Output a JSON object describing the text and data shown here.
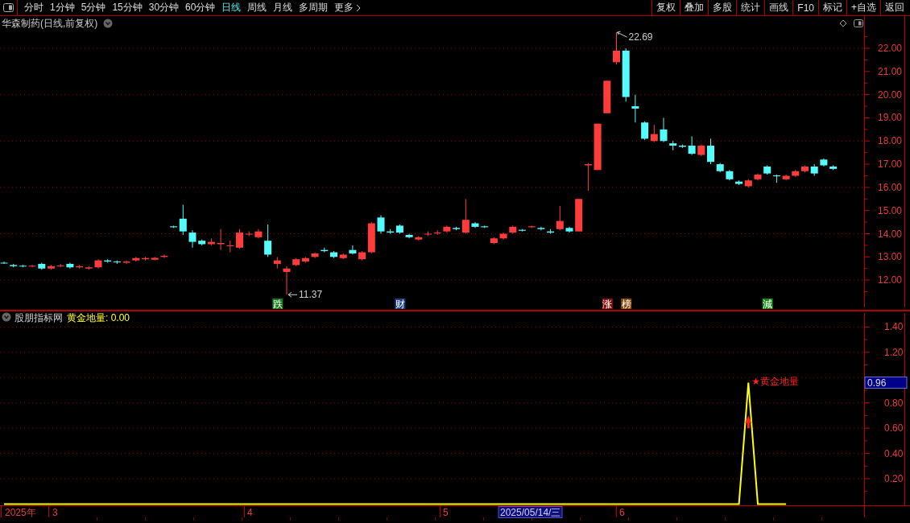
{
  "toolbar": {
    "periods": [
      {
        "label": "分时",
        "selected": false
      },
      {
        "label": "1分钟",
        "selected": false
      },
      {
        "label": "5分钟",
        "selected": false
      },
      {
        "label": "15分钟",
        "selected": false
      },
      {
        "label": "30分钟",
        "selected": false
      },
      {
        "label": "60分钟",
        "selected": false
      },
      {
        "label": "日线",
        "selected": true
      },
      {
        "label": "周线",
        "selected": false
      },
      {
        "label": "月线",
        "selected": false
      },
      {
        "label": "多周期",
        "selected": false
      }
    ],
    "more": "更多",
    "buttons": [
      "复权",
      "叠加",
      "多股",
      "统计",
      "画线",
      "F10",
      "标记",
      "+自选",
      "返回"
    ]
  },
  "price_chart": {
    "title": "华森制药(日线,前复权)",
    "high_label": "22.69",
    "low_label": "11.37",
    "markers": [
      {
        "text": "跌",
        "color": "#167a16"
      },
      {
        "text": "财",
        "color": "#1c3f8a"
      },
      {
        "text": "涨",
        "color": "#8a1010"
      },
      {
        "text": "榜",
        "color": "#8a4a10"
      },
      {
        "text": "減",
        "color": "#168a16"
      }
    ],
    "chart_data": {
      "type": "candlestick",
      "ylim": [
        10.72,
        23.39
      ],
      "yticks": [
        {
          "value": 22,
          "label": "22.00"
        },
        {
          "value": 21,
          "label": "21.00"
        },
        {
          "value": 20,
          "label": "20.00"
        },
        {
          "value": 19,
          "label": "19.00"
        },
        {
          "value": 18,
          "label": "18.00"
        },
        {
          "value": 17,
          "label": "17.00"
        },
        {
          "value": 16,
          "label": "16.00"
        },
        {
          "value": 15,
          "label": "15.00"
        },
        {
          "value": 14,
          "label": "14.00"
        },
        {
          "value": 13,
          "label": "13.00"
        },
        {
          "value": 12,
          "label": "12.00"
        }
      ],
      "categories": [
        null,
        null,
        null,
        null,
        null,
        null,
        null,
        null,
        null,
        null,
        null,
        null,
        null,
        null,
        null,
        null,
        null,
        null,
        null,
        null,
        null,
        null,
        null,
        null,
        null,
        null,
        null,
        null,
        null,
        null,
        null,
        null,
        null,
        null,
        null,
        null,
        null,
        null,
        null,
        null,
        null,
        null,
        null,
        null,
        null,
        null,
        null,
        null,
        null,
        null,
        null,
        null,
        null,
        null,
        null,
        null,
        null,
        null,
        null,
        null,
        null,
        null,
        null,
        null,
        null,
        null,
        null,
        null,
        null,
        null,
        null,
        null,
        null,
        null,
        null,
        null,
        null,
        null,
        null,
        null,
        null,
        null,
        null,
        null,
        null,
        null,
        null,
        null,
        null
      ],
      "ohlc": [
        [
          12.75,
          12.8,
          12.7,
          12.72
        ],
        [
          12.65,
          12.7,
          12.55,
          12.6
        ],
        [
          12.62,
          12.66,
          12.55,
          12.6
        ],
        [
          12.6,
          12.66,
          12.55,
          12.62
        ],
        [
          12.7,
          12.75,
          12.45,
          12.5
        ],
        [
          12.5,
          12.65,
          12.45,
          12.6
        ],
        [
          12.6,
          12.7,
          12.55,
          12.63
        ],
        [
          12.7,
          12.75,
          12.5,
          12.55
        ],
        [
          12.55,
          12.65,
          12.5,
          12.6
        ],
        [
          12.5,
          12.6,
          12.45,
          12.55
        ],
        [
          12.55,
          12.9,
          12.5,
          12.85
        ],
        [
          12.85,
          12.9,
          12.75,
          12.8
        ],
        [
          12.8,
          12.85,
          12.7,
          12.78
        ],
        [
          12.75,
          12.85,
          12.7,
          12.8
        ],
        [
          12.85,
          13.0,
          12.8,
          12.95
        ],
        [
          12.9,
          13.0,
          12.85,
          12.95
        ],
        [
          12.88,
          13.0,
          12.85,
          12.96
        ],
        [
          13.0,
          13.1,
          12.95,
          13.05
        ],
        [
          14.32,
          14.35,
          14.25,
          14.28
        ],
        [
          14.65,
          15.25,
          13.95,
          14.1
        ],
        [
          14.05,
          14.15,
          13.4,
          13.65
        ],
        [
          13.7,
          13.75,
          13.5,
          13.55
        ],
        [
          13.55,
          13.8,
          13.5,
          13.65
        ],
        [
          13.55,
          14.2,
          13.3,
          13.6
        ],
        [
          13.5,
          13.7,
          13.2,
          13.5
        ],
        [
          13.4,
          14.2,
          13.35,
          14.05
        ],
        [
          14.0,
          14.1,
          13.9,
          14.0
        ],
        [
          13.85,
          14.2,
          13.8,
          14.1
        ],
        [
          13.7,
          14.4,
          13.0,
          13.1
        ],
        [
          12.7,
          13.0,
          12.5,
          12.85
        ],
        [
          12.35,
          12.6,
          11.37,
          12.5
        ],
        [
          12.65,
          12.95,
          12.6,
          12.9
        ],
        [
          12.8,
          13.0,
          12.75,
          12.95
        ],
        [
          13.0,
          13.2,
          12.95,
          13.15
        ],
        [
          13.3,
          13.4,
          13.2,
          13.25
        ],
        [
          13.2,
          13.25,
          12.95,
          13.0
        ],
        [
          12.95,
          13.15,
          12.9,
          13.1
        ],
        [
          13.3,
          13.5,
          13.1,
          13.15
        ],
        [
          12.9,
          13.25,
          12.85,
          13.2
        ],
        [
          13.2,
          14.5,
          13.15,
          14.45
        ],
        [
          14.7,
          14.8,
          14.0,
          14.1
        ],
        [
          14.1,
          14.2,
          14.0,
          14.05
        ],
        [
          14.35,
          14.4,
          14.0,
          14.05
        ],
        [
          13.95,
          14.0,
          13.8,
          13.85
        ],
        [
          13.75,
          13.9,
          13.7,
          13.85
        ],
        [
          14.0,
          14.1,
          13.9,
          14.0
        ],
        [
          14.05,
          14.15,
          13.95,
          14.05
        ],
        [
          14.1,
          14.35,
          14.05,
          14.3
        ],
        [
          14.25,
          14.3,
          14.15,
          14.2
        ],
        [
          14.05,
          15.5,
          14.0,
          14.6
        ],
        [
          14.45,
          14.5,
          14.25,
          14.3
        ],
        [
          14.32,
          14.35,
          14.25,
          14.28
        ],
        [
          13.6,
          13.85,
          13.55,
          13.8
        ],
        [
          13.8,
          14.05,
          13.75,
          14.0
        ],
        [
          14.05,
          14.35,
          14.0,
          14.3
        ],
        [
          14.17,
          14.2,
          14.1,
          14.13
        ],
        [
          14.28,
          14.35,
          14.25,
          14.32
        ],
        [
          14.25,
          14.3,
          14.15,
          14.2
        ],
        [
          14.1,
          14.2,
          14.0,
          14.05
        ],
        [
          14.2,
          15.2,
          14.15,
          14.55
        ],
        [
          14.25,
          14.3,
          14.05,
          14.1
        ],
        [
          14.1,
          15.5,
          14.1,
          15.5
        ],
        [
          16.95,
          17.05,
          15.85,
          17.0
        ],
        [
          16.75,
          18.75,
          16.75,
          18.75
        ],
        [
          19.2,
          20.6,
          19.2,
          20.6
        ],
        [
          21.4,
          22.69,
          21.3,
          21.9
        ],
        [
          21.9,
          22.0,
          19.7,
          19.9
        ],
        [
          19.5,
          20.0,
          18.8,
          19.4
        ],
        [
          18.8,
          18.85,
          18.05,
          18.1
        ],
        [
          18.0,
          18.7,
          17.95,
          18.3
        ],
        [
          18.5,
          19.0,
          17.95,
          18.0
        ],
        [
          17.9,
          18.0,
          17.6,
          17.8
        ],
        [
          17.8,
          17.85,
          17.7,
          17.75
        ],
        [
          17.8,
          18.2,
          17.4,
          17.45
        ],
        [
          17.4,
          17.85,
          17.35,
          17.8
        ],
        [
          17.8,
          18.1,
          17.0,
          17.1
        ],
        [
          17.0,
          17.05,
          16.65,
          16.7
        ],
        [
          16.7,
          16.75,
          16.3,
          16.35
        ],
        [
          16.25,
          16.3,
          16.1,
          16.15
        ],
        [
          16.05,
          16.35,
          16.0,
          16.3
        ],
        [
          16.35,
          16.6,
          16.3,
          16.55
        ],
        [
          16.9,
          16.95,
          16.55,
          16.6
        ],
        [
          16.52,
          16.55,
          16.2,
          16.48
        ],
        [
          16.35,
          16.55,
          16.3,
          16.5
        ],
        [
          16.5,
          16.75,
          16.45,
          16.7
        ],
        [
          16.7,
          16.95,
          16.65,
          16.9
        ],
        [
          16.9,
          17.0,
          16.5,
          16.6
        ],
        [
          17.2,
          17.25,
          16.9,
          16.95
        ],
        [
          16.9,
          16.95,
          16.75,
          16.8
        ]
      ]
    }
  },
  "indicator": {
    "source": "股朋指标网",
    "reading": "黄金地量: 0.00",
    "peak_label": "★黄金地量",
    "current_value": "0.96",
    "chart_data": {
      "type": "line",
      "ylim": [
        -0.01,
        1.53
      ],
      "yticks": [
        {
          "value": 0.2,
          "label": "0.20"
        },
        {
          "value": 0.4,
          "label": "0.40"
        },
        {
          "value": 0.6,
          "label": "0.60"
        },
        {
          "value": 0.8,
          "label": "0.80"
        },
        {
          "value": 1.2,
          "label": "1.20"
        },
        {
          "value": 1.4,
          "label": "1.40"
        }
      ],
      "categories": [
        null,
        null,
        null,
        null,
        null,
        null,
        null,
        null,
        null,
        null,
        null,
        null,
        null,
        null,
        null,
        null,
        null,
        null,
        null,
        null,
        null,
        null,
        null,
        null,
        null,
        null,
        null,
        null,
        null,
        null,
        null,
        null,
        null,
        null,
        null,
        null,
        null,
        null,
        null,
        null,
        null,
        null,
        null,
        null,
        null,
        null,
        null,
        null,
        null,
        null,
        null,
        null,
        null,
        null,
        null,
        null,
        null,
        null,
        null,
        null,
        null,
        null,
        null,
        null,
        null,
        null,
        null,
        null,
        null,
        null,
        null,
        null,
        null,
        null,
        null,
        null,
        null,
        null,
        null,
        null,
        null,
        null,
        null,
        null
      ],
      "series": [
        {
          "color": "#ffff00",
          "values": [
            0,
            0,
            0,
            0,
            0,
            0,
            0,
            0,
            0,
            0,
            0,
            0,
            0,
            0,
            0,
            0,
            0,
            0,
            0,
            0,
            0,
            0,
            0,
            0,
            0,
            0,
            0,
            0,
            0,
            0,
            0,
            0,
            0,
            0,
            0,
            0,
            0,
            0,
            0,
            0,
            0,
            0,
            0,
            0,
            0,
            0,
            0,
            0,
            0,
            0,
            0,
            0,
            0,
            0,
            0,
            0,
            0,
            0,
            0,
            0,
            0,
            0,
            0,
            0,
            0,
            0,
            0,
            0,
            0,
            0,
            0,
            0,
            0,
            0,
            0,
            0,
            0,
            0,
            0,
            0.96,
            0,
            0,
            0,
            0
          ]
        }
      ]
    }
  },
  "date_axis": {
    "labels": [
      {
        "text": "2025年",
        "selected": false
      },
      {
        "text": "3",
        "selected": false
      },
      {
        "text": "4",
        "selected": false
      },
      {
        "text": "5",
        "selected": false
      },
      {
        "text": "2025/05/14/三",
        "selected": true
      },
      {
        "text": "6",
        "selected": false
      }
    ]
  }
}
